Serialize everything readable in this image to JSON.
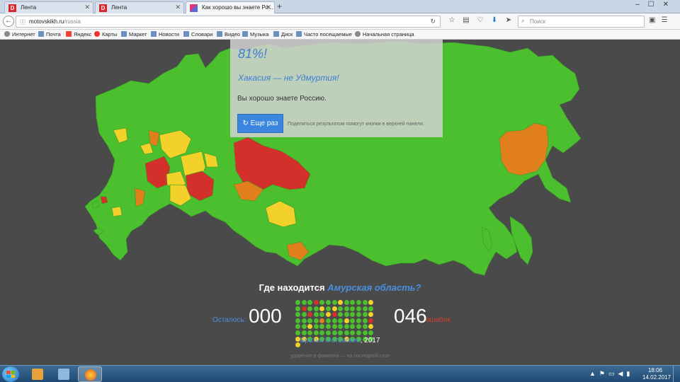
{
  "browser": {
    "tabs": [
      {
        "title": "Лента",
        "favicon": "D",
        "favicon_color": "#d9242a"
      },
      {
        "title": "Лента",
        "favicon": "D",
        "favicon_color": "#d9242a"
      },
      {
        "title": "Как хорошо вы знаете Ро...",
        "favicon": "",
        "favicon_color": "#e2337a"
      }
    ],
    "address": {
      "host": "motovskikh.ru",
      "path": "/russia"
    },
    "search_placeholder": "Поиск",
    "bookmarks": [
      "Интернет",
      "Почта",
      "Яндекс",
      "Карты",
      "Маркет",
      "Новости",
      "Словари",
      "Видео",
      "Музыка",
      "Диск",
      "Часто посещаемые",
      "Начальная страница"
    ]
  },
  "result": {
    "score": "81%!",
    "title": "Хакасия — не Удмуртия!",
    "text": "Вы хорошо знаете Россию.",
    "retry_button": "↻ Еще раз",
    "share_note": "Поделиться результатом помогут кнопки в верхней панели."
  },
  "quiz": {
    "question_prefix": "Где находится",
    "question_region": "Амурская область?",
    "remaining_label": "Осталось:",
    "remaining": "000",
    "errors": "046",
    "errors_label": "ошибок",
    "credit_link": "Братья Мотовские",
    "credit_suffix": ", 2017",
    "footnote": "ударение в фамилии — на последний слог"
  },
  "colors": {
    "green": "#4bbf2e",
    "yellow": "#f2d22a",
    "orange": "#e07f1c",
    "red": "#d4302b",
    "accent": "#4a8fe2"
  },
  "progress_dots": [
    "g",
    "g",
    "g",
    "r",
    "g",
    "g",
    "g",
    "y",
    "g",
    "g",
    "g",
    "g",
    "y",
    "g",
    "r",
    "g",
    "g",
    "y",
    "g",
    "y",
    "g",
    "g",
    "g",
    "g",
    "g",
    "g",
    "g",
    "g",
    "r",
    "g",
    "g",
    "y",
    "r",
    "g",
    "g",
    "g",
    "g",
    "g",
    "y",
    "g",
    "g",
    "g",
    "g",
    "o",
    "g",
    "g",
    "g",
    "y",
    "g",
    "g",
    "g",
    "r",
    "g",
    "g",
    "y",
    "g",
    "g",
    "g",
    "g",
    "g",
    "g",
    "g",
    "g",
    "g",
    "y",
    "g",
    "g",
    "g",
    "g",
    "g",
    "g",
    "g",
    "g",
    "g",
    "g",
    "g",
    "g",
    "g",
    "y",
    "y",
    "g",
    "y",
    "g",
    "g",
    "g",
    "g",
    "y",
    "g",
    "g",
    "g",
    "g",
    "y"
  ],
  "taskbar": {
    "time": "18:06",
    "date": "14.02.2017"
  }
}
